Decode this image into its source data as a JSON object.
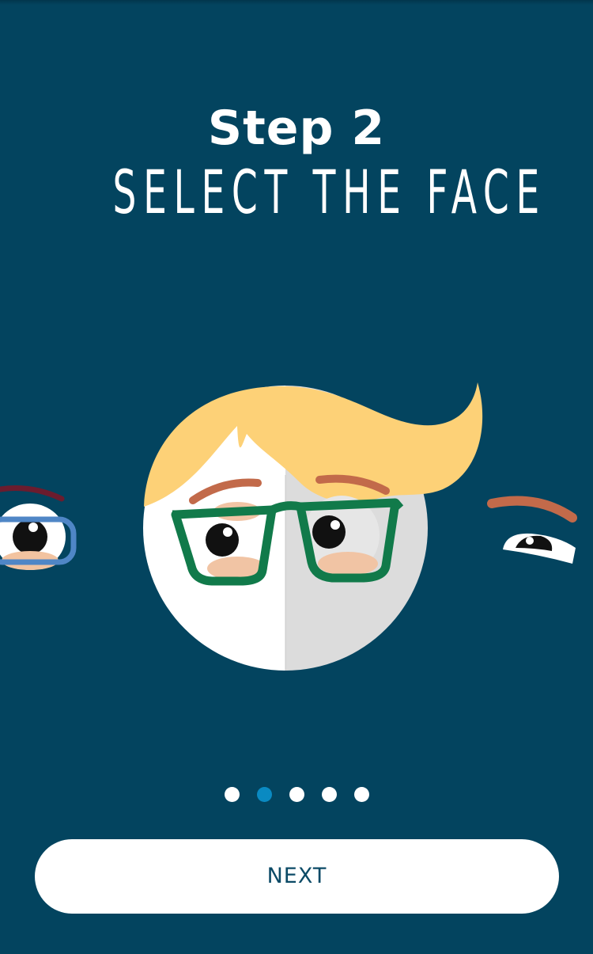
{
  "header": {
    "step_label": "Step 2",
    "instruction": "SELECT THE FACE"
  },
  "carousel": {
    "faces": [
      {
        "name": "previous-face",
        "state": "partial"
      },
      {
        "name": "selected-face",
        "state": "active",
        "glasses_color": "#117a4a",
        "hair_color": "#fdd177"
      },
      {
        "name": "next-face",
        "state": "partial"
      }
    ]
  },
  "pagination": {
    "total": 5,
    "active_index": 1
  },
  "actions": {
    "next_label": "NEXT"
  },
  "colors": {
    "background": "#03445f",
    "active_dot": "#0a8ac2",
    "button_text": "#0b4a66"
  }
}
